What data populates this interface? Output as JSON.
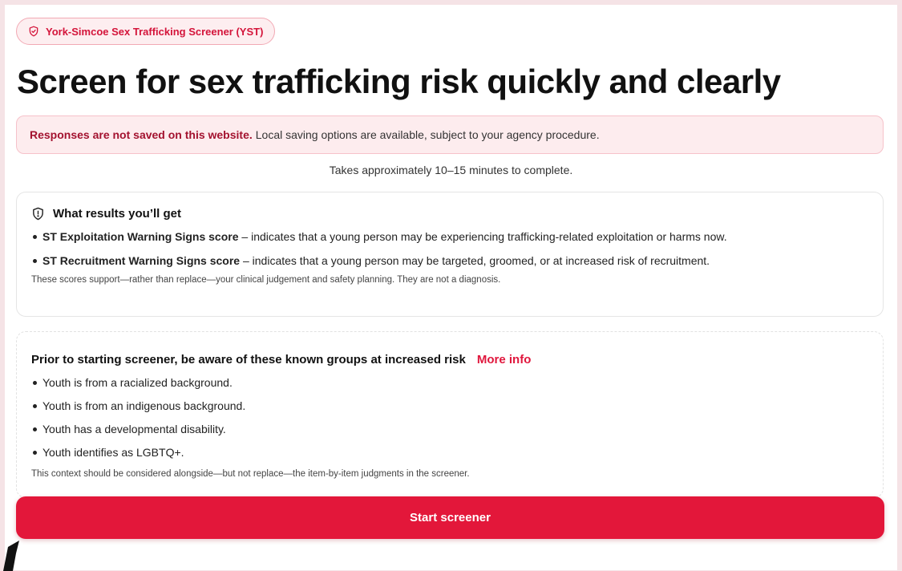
{
  "badge": {
    "label": "York-Simcoe Sex Trafficking Screener (YST)",
    "icon": "shield-check-icon"
  },
  "title": "Screen for sex trafficking risk quickly and clearly",
  "notice": {
    "bold": "Responses are not saved on this website.",
    "text": "Local saving options are available, subject to your agency procedure."
  },
  "duration": "Takes approximately 10–15 minutes to complete.",
  "results": {
    "icon": "alert-shield-icon",
    "heading": "What results you’ll get",
    "items": [
      {
        "bold": "ST Exploitation Warning Signs score",
        "text": " – indicates that a young person may be experiencing trafficking-related exploitation or harms now."
      },
      {
        "bold": "ST Recruitment Warning Signs score",
        "text": " – indicates that a young person may be targeted, groomed, or at increased risk of recruitment."
      }
    ],
    "note": "These scores support—rather than replace—your clinical judgement and safety planning. They are not a diagnosis."
  },
  "groups": {
    "heading": "Prior to starting screener, be aware of these known groups at increased risk",
    "more_info": "More info",
    "items": [
      "Youth is from a racialized background.",
      "Youth is from an indigenous background.",
      "Youth has a developmental disability.",
      "Youth identifies as LGBTQ+."
    ],
    "note": "This context should be considered alongside—but not replace—the item-by-item judgments in the screener."
  },
  "start_button": "Start screener",
  "colors": {
    "accent": "#e3173a",
    "background": "#f5e3e6",
    "notice_bg": "#fdecee"
  }
}
